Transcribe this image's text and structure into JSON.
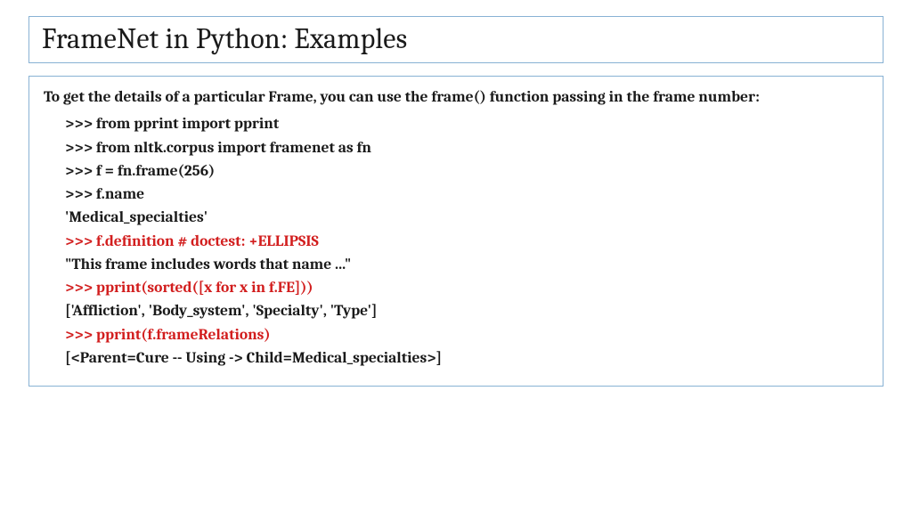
{
  "title": "FrameNet in Python: Examples",
  "intro": "To get the details of a particular Frame, you can use the frame() function passing in the frame number:",
  "lines": [
    {
      "text": ">>> from pprint import pprint",
      "red": false
    },
    {
      "text": ">>> from nltk.corpus import framenet as fn",
      "red": false
    },
    {
      "text": ">>> f = fn.frame(256)",
      "red": false
    },
    {
      "text": ">>> f.name",
      "red": false
    },
    {
      "text": "'Medical_specialties'",
      "red": false
    },
    {
      "text": ">>> f.definition # doctest: +ELLIPSIS",
      "red": true
    },
    {
      "text": "\"This frame includes words that name ...\"",
      "red": false
    },
    {
      "text": " >>> pprint(sorted([x for x in f.FE]))",
      "red": true
    },
    {
      "text": "['Affliction', 'Body_system', 'Specialty', 'Type']",
      "red": false
    },
    {
      "text": ">>> pprint(f.frameRelations)",
      "red": true
    },
    {
      "text": "[<Parent=Cure -- Using -> Child=Medical_specialties>]",
      "red": false
    }
  ]
}
